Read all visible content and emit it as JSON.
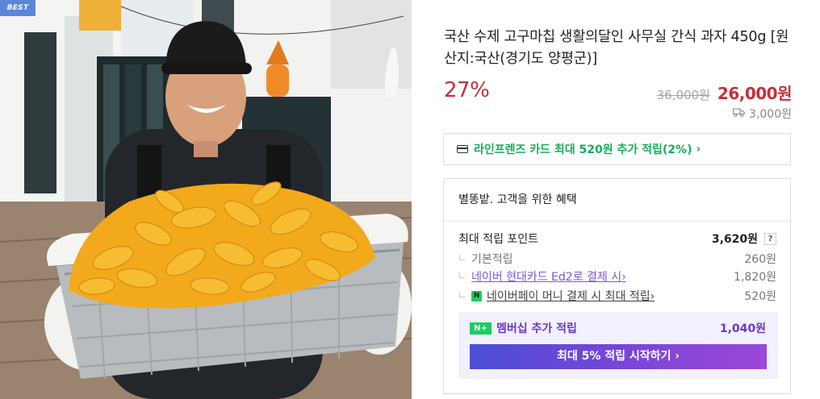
{
  "badge": "BEST",
  "product": {
    "title": "국산 수제 고구마칩 생활의달인 사무실 간식 과자 450g [원산지:국산(경기도 양평군)]",
    "discount_rate": "27%",
    "original_price": "36,000원",
    "sale_price": "26,000원",
    "shipping_fee": "3,000원"
  },
  "card_banner": {
    "text": "라인프렌즈 카드 최대 520원 추가 적립(2%)",
    "chevron": "›",
    "icon": "credit-card-icon"
  },
  "benefits": {
    "title": "별똥밭. 고객을 위한 혜택",
    "max_points_label": "최대 적립 포인트",
    "max_points_value": "3,620원",
    "help": "?",
    "items": [
      {
        "label": "기본적립",
        "value": "260원"
      },
      {
        "label": "네이버 현대카드 Ed2로 결제 시",
        "chevron": "›",
        "value": "1,820원"
      },
      {
        "badge": "N",
        "label": "네이버페이 머니 결제 시 최대 적립",
        "chevron": "›",
        "value": "520원"
      }
    ],
    "membership": {
      "badge": "N+",
      "label": "멤버십 추가 적립",
      "value": "1,040원",
      "button": "최대 5% 적립 시작하기 ›"
    }
  },
  "colors": {
    "price_red": "#c2303d",
    "card_green": "#17ae5a",
    "naver_green": "#19ce60",
    "membership_purple": "#6b38cf",
    "badge_blue": "#5b87d9"
  }
}
